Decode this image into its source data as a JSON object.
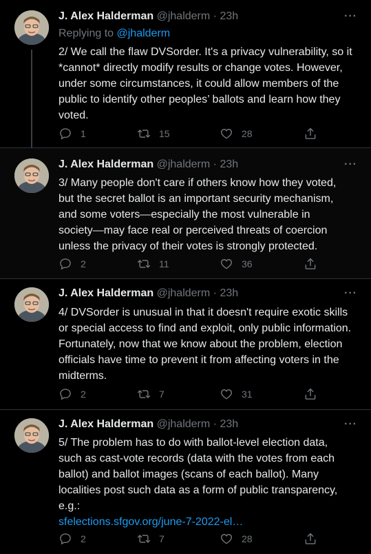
{
  "accent": "#1d9bf0",
  "reply_prefix": "Replying to",
  "tweets": [
    {
      "name": "J. Alex Halderman",
      "handle": "@jhalderm",
      "sep": "·",
      "time": "23h",
      "more": "···",
      "reply_to": "@jhalderm",
      "lines": [
        "2/ We call the flaw DVSorder. It's a privacy vulnerability, so it",
        "*cannot* directly modify results or change votes. However,",
        "under some circumstances, it could allow members of the",
        "public to identify other peoples’ ballots and learn how they",
        "voted."
      ],
      "replies": "1",
      "retweets": "15",
      "likes": "28"
    },
    {
      "name": "J. Alex Halderman",
      "handle": "@jhalderm",
      "sep": "·",
      "time": "23h",
      "more": "···",
      "lines": [
        "3/ Many people don't care if others know how they voted,",
        "but the secret ballot is an important security mechanism,",
        "and some voters—especially the most vulnerable in",
        "society—may face real or perceived threats of coercion",
        "unless the privacy of their votes is strongly protected."
      ],
      "replies": "2",
      "retweets": "11",
      "likes": "36"
    },
    {
      "name": "J. Alex Halderman",
      "handle": "@jhalderm",
      "sep": "·",
      "time": "23h",
      "more": "···",
      "lines": [
        "4/ DVSorder is unusual in that it doesn't require exotic skills",
        "or special access to find and exploit, only public information.",
        "Fortunately, now that we know about the problem, election",
        "officials have time to prevent it from affecting voters in the",
        "midterms."
      ],
      "replies": "2",
      "retweets": "7",
      "likes": "31"
    },
    {
      "name": "J. Alex Halderman",
      "handle": "@jhalderm",
      "sep": "·",
      "time": "23h",
      "more": "···",
      "lines": [
        "5/ The problem has to do with ballot-level election data,",
        "such as cast-vote records (data with the votes from each",
        "ballot) and ballot images (scans of each ballot). Many",
        "localities post such data as a form of public transparency,",
        "e.g.:"
      ],
      "link": "sfelections.sfgov.org/june-7-2022-el…",
      "replies": "2",
      "retweets": "7",
      "likes": "28"
    }
  ]
}
